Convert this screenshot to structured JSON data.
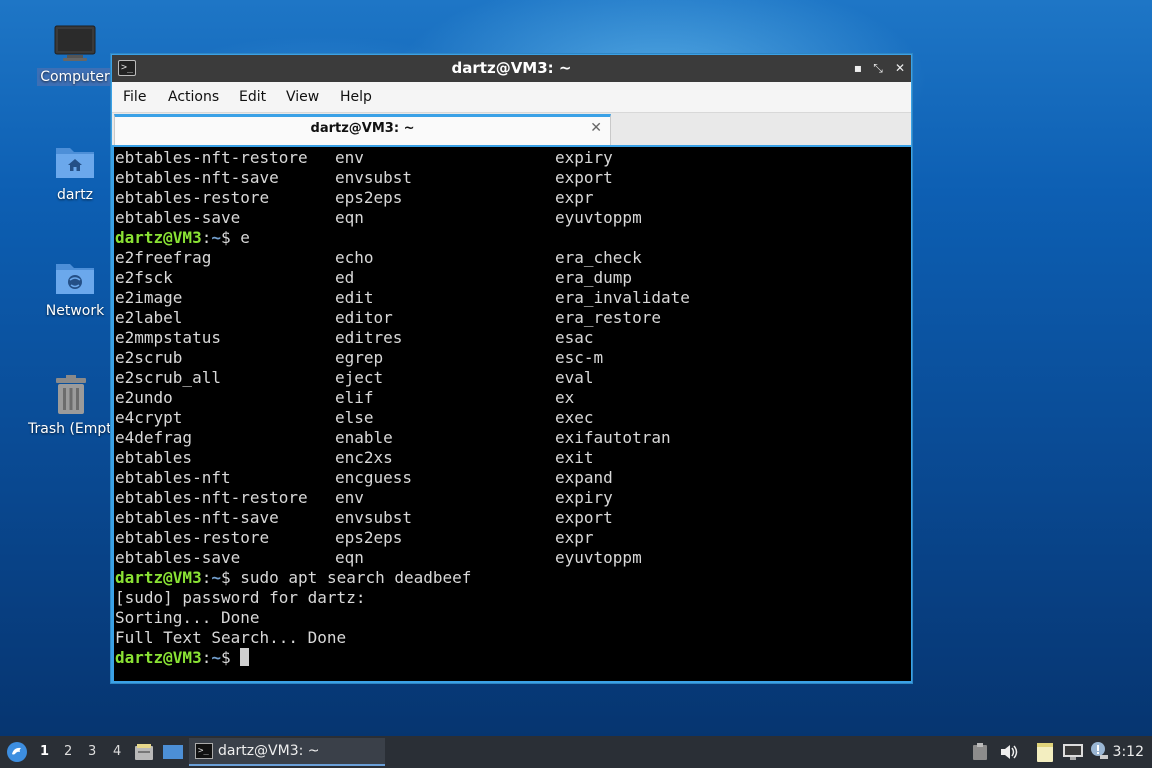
{
  "desktop": {
    "icons": [
      {
        "label": "Computer"
      },
      {
        "label": "dartz"
      },
      {
        "label": "Network"
      },
      {
        "label": "Trash (Empty)"
      }
    ]
  },
  "window": {
    "title": "dartz@VM3: ~",
    "controls": {
      "minimize": "▪",
      "maximize": "⤡",
      "close": "✕"
    },
    "menu": [
      "File",
      "Actions",
      "Edit",
      "View",
      "Help"
    ],
    "tab": {
      "title": "dartz@VM3: ~",
      "close": "✕"
    }
  },
  "terminal": {
    "top_rows": [
      [
        "ebtables-nft-restore",
        "env",
        "expiry"
      ],
      [
        "ebtables-nft-save",
        "envsubst",
        "export"
      ],
      [
        "ebtables-restore",
        "eps2eps",
        "expr"
      ],
      [
        "ebtables-save",
        "eqn",
        "eyuvtoppm"
      ]
    ],
    "prompt": {
      "user": "dartz@VM3",
      "sep": ":",
      "path": "~",
      "sym": "$ "
    },
    "cmd1": "e",
    "rows": [
      [
        "e2freefrag",
        "echo",
        "era_check"
      ],
      [
        "e2fsck",
        "ed",
        "era_dump"
      ],
      [
        "e2image",
        "edit",
        "era_invalidate"
      ],
      [
        "e2label",
        "editor",
        "era_restore"
      ],
      [
        "e2mmpstatus",
        "editres",
        "esac"
      ],
      [
        "e2scrub",
        "egrep",
        "esc-m"
      ],
      [
        "e2scrub_all",
        "eject",
        "eval"
      ],
      [
        "e2undo",
        "elif",
        "ex"
      ],
      [
        "e4crypt",
        "else",
        "exec"
      ],
      [
        "e4defrag",
        "enable",
        "exifautotran"
      ],
      [
        "ebtables",
        "enc2xs",
        "exit"
      ],
      [
        "ebtables-nft",
        "encguess",
        "expand"
      ],
      [
        "ebtables-nft-restore",
        "env",
        "expiry"
      ],
      [
        "ebtables-nft-save",
        "envsubst",
        "export"
      ],
      [
        "ebtables-restore",
        "eps2eps",
        "expr"
      ],
      [
        "ebtables-save",
        "eqn",
        "eyuvtoppm"
      ]
    ],
    "cmd2": "sudo apt search deadbeef",
    "output": [
      "[sudo] password for dartz:",
      "Sorting... Done",
      "Full Text Search... Done"
    ]
  },
  "taskbar": {
    "workspaces": [
      "1",
      "2",
      "3",
      "4"
    ],
    "task_label": "dartz@VM3: ~",
    "clock": "3:12"
  }
}
